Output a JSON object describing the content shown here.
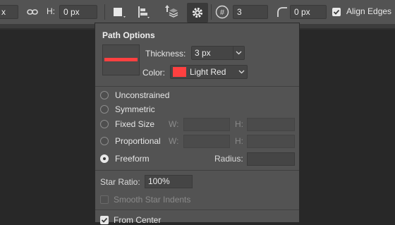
{
  "toolbar": {
    "w_partial": "x",
    "h_label": "H:",
    "h_value": "0 px",
    "star_count": "3",
    "corner_radius": "0 px",
    "align_edges_label": "Align Edges",
    "align_edges_checked": true
  },
  "panel": {
    "title": "Path Options",
    "thickness_label": "Thickness:",
    "thickness_value": "3 px",
    "color_label": "Color:",
    "color_value": "Light Red",
    "stroke_color": "#ff4040",
    "options": [
      {
        "label": "Unconstrained",
        "selected": false
      },
      {
        "label": "Symmetric",
        "selected": false
      },
      {
        "label": "Fixed Size",
        "selected": false
      },
      {
        "label": "Proportional",
        "selected": false
      },
      {
        "label": "Freeform",
        "selected": true
      }
    ],
    "w_label": "W:",
    "h_label": "H:",
    "radius_label": "Radius:",
    "star_ratio_label": "Star Ratio:",
    "star_ratio_value": "100%",
    "smooth_indents_label": "Smooth Star Indents",
    "smooth_indents_checked": false,
    "from_center_label": "From Center",
    "from_center_checked": true
  }
}
